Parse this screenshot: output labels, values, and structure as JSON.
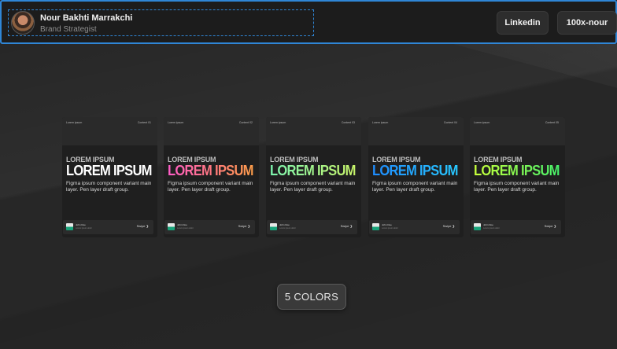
{
  "header": {
    "name": "Nour Bakhti Marrakchi",
    "role": "Brand Strategist",
    "buttons": {
      "linkedin": "Linkedin",
      "site": "100x-nour"
    }
  },
  "cards": [
    {
      "top_left": "Lorem ipsum",
      "top_right": "Content 01",
      "kicker": "LOREM IPSUM",
      "headline": "LOREM IPSUM",
      "body": "Figma ipsum component variant main layer. Pen layer draft group.",
      "author": "John Doe",
      "author_sub": "Lorem ipsum dolor",
      "action": "Swipe ❯",
      "accent": "#ffffff"
    },
    {
      "top_left": "Lorem ipsum",
      "top_right": "Content 02",
      "kicker": "LOREM IPSUM",
      "headline": "LOREM IPSUM",
      "body": "Figma ipsum component variant main layer. Pen layer draft group.",
      "author": "John Doe",
      "author_sub": "Lorem ipsum dolor",
      "action": "Swipe ❯",
      "accent": "#ff6fb5"
    },
    {
      "top_left": "Lorem ipsum",
      "top_right": "Content 03",
      "kicker": "LOREM IPSUM",
      "headline": "LOREM IPSUM",
      "body": "Figma ipsum component variant main layer. Pen layer draft group.",
      "author": "John Doe",
      "author_sub": "Lorem ipsum dolor",
      "action": "Swipe ❯",
      "accent": "#a8f58a"
    },
    {
      "top_left": "Lorem ipsum",
      "top_right": "Content 04",
      "kicker": "LOREM IPSUM",
      "headline": "LOREM IPSUM",
      "body": "Figma ipsum component variant main layer. Pen layer draft group.",
      "author": "John Doe",
      "author_sub": "Lorem ipsum dolor",
      "action": "Swipe ❯",
      "accent": "#1e8cff"
    },
    {
      "top_left": "Lorem ipsum",
      "top_right": "Content 05",
      "kicker": "LOREM IPSUM",
      "headline": "LOREM IPSUM",
      "body": "Figma ipsum component variant main layer. Pen layer draft group.",
      "author": "John Doe",
      "author_sub": "Lorem ipsum dolor",
      "action": "Swipe ❯",
      "accent": "#9ff542"
    }
  ],
  "footer": {
    "colors_label": "5 COLORS"
  },
  "colors": {
    "header_border": "#2f86d6",
    "background": "#262626"
  }
}
